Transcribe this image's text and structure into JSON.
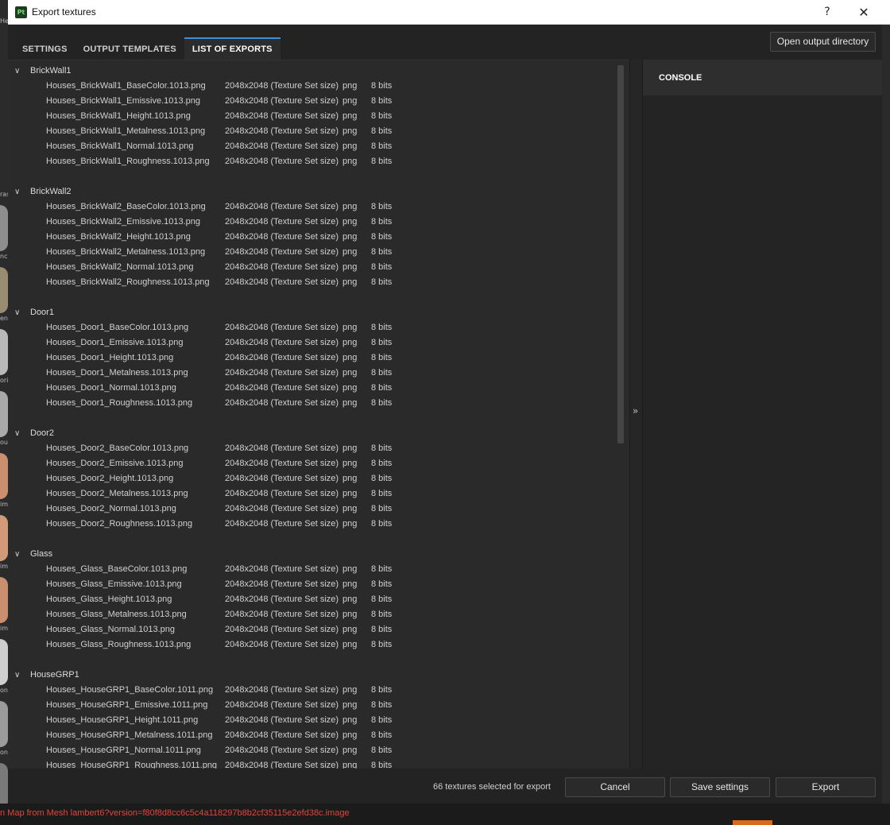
{
  "window": {
    "title": "Export textures",
    "app_icon": "Pt",
    "help": "?",
    "close": "✕"
  },
  "tabs": [
    {
      "label": "SETTINGS",
      "active": false
    },
    {
      "label": "OUTPUT TEMPLATES",
      "active": false
    },
    {
      "label": "LIST OF EXPORTS",
      "active": true
    }
  ],
  "open_dir_label": "Open output directory",
  "console_label": "CONSOLE",
  "collapse_icon": "»",
  "groups": [
    {
      "name": "BrickWall1",
      "files": [
        "Houses_BrickWall1_BaseColor.1013.png",
        "Houses_BrickWall1_Emissive.1013.png",
        "Houses_BrickWall1_Height.1013.png",
        "Houses_BrickWall1_Metalness.1013.png",
        "Houses_BrickWall1_Normal.1013.png",
        "Houses_BrickWall1_Roughness.1013.png"
      ]
    },
    {
      "name": "BrickWall2",
      "files": [
        "Houses_BrickWall2_BaseColor.1013.png",
        "Houses_BrickWall2_Emissive.1013.png",
        "Houses_BrickWall2_Height.1013.png",
        "Houses_BrickWall2_Metalness.1013.png",
        "Houses_BrickWall2_Normal.1013.png",
        "Houses_BrickWall2_Roughness.1013.png"
      ]
    },
    {
      "name": "Door1",
      "files": [
        "Houses_Door1_BaseColor.1013.png",
        "Houses_Door1_Emissive.1013.png",
        "Houses_Door1_Height.1013.png",
        "Houses_Door1_Metalness.1013.png",
        "Houses_Door1_Normal.1013.png",
        "Houses_Door1_Roughness.1013.png"
      ]
    },
    {
      "name": "Door2",
      "files": [
        "Houses_Door2_BaseColor.1013.png",
        "Houses_Door2_Emissive.1013.png",
        "Houses_Door2_Height.1013.png",
        "Houses_Door2_Metalness.1013.png",
        "Houses_Door2_Normal.1013.png",
        "Houses_Door2_Roughness.1013.png"
      ]
    },
    {
      "name": "Glass",
      "files": [
        "Houses_Glass_BaseColor.1013.png",
        "Houses_Glass_Emissive.1013.png",
        "Houses_Glass_Height.1013.png",
        "Houses_Glass_Metalness.1013.png",
        "Houses_Glass_Normal.1013.png",
        "Houses_Glass_Roughness.1013.png"
      ]
    },
    {
      "name": "HouseGRP1",
      "files": [
        "Houses_HouseGRP1_BaseColor.1011.png",
        "Houses_HouseGRP1_Emissive.1011.png",
        "Houses_HouseGRP1_Height.1011.png",
        "Houses_HouseGRP1_Metalness.1011.png",
        "Houses_HouseGRP1_Normal.1011.png",
        "Houses_HouseGRP1_Roughness.1011.png"
      ]
    }
  ],
  "row_size": "2048x2048 (Texture Set size)",
  "row_format": "png",
  "row_bits": "8 bits",
  "footer": {
    "count": "66 textures selected for export",
    "cancel": "Cancel",
    "save": "Save settings",
    "export": "Export"
  },
  "status_message": "n Map from Mesh lambert6?version=f80f8d8cc6c5c4a118297b8b2cf35115e2efd38c.image",
  "background_labels": [
    "He",
    "ras",
    "nc",
    "eni",
    "ori",
    "ou",
    "im",
    "im",
    "im",
    "on",
    "on"
  ],
  "colors": {
    "accent_tab": "#3d8fd6",
    "status_error": "#e0453c"
  }
}
